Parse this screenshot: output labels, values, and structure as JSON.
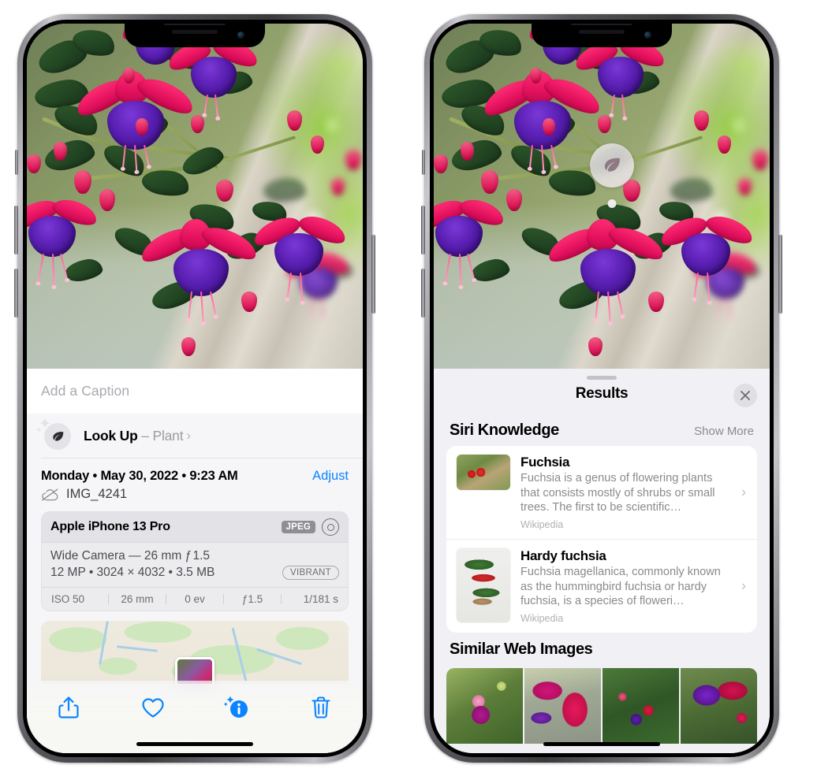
{
  "left_phone": {
    "name": "iphone-photos-info-view",
    "photo": {
      "alt_name": "fuchsia-flowers-photo"
    },
    "caption": {
      "placeholder": "Add a Caption",
      "value": ""
    },
    "look_up": {
      "label": "Look Up",
      "dash": "–",
      "subject": "Plant",
      "chevron": "›",
      "icon": "leaf-icon"
    },
    "date_row": {
      "date_text": "Monday • May 30, 2022 • 9:23 AM",
      "adjust_label": "Adjust"
    },
    "filename_row": {
      "icon": "cloud-slash-icon",
      "filename": "IMG_4241"
    },
    "metadata": {
      "device": "Apple iPhone 13 Pro",
      "format_badge": "JPEG",
      "aperture_icon": "aperture-icon",
      "lens_line": "Wide Camera — 26 mm ƒ 1.5",
      "size_line": "12 MP • 3024 × 4032 • 3.5 MB",
      "style_badge": "VIBRANT",
      "exif": [
        {
          "label": "ISO 50"
        },
        {
          "label": "26 mm"
        },
        {
          "label": "0 ev"
        },
        {
          "label": "ƒ1.5"
        },
        {
          "label": "1/181 s"
        }
      ]
    },
    "map": {
      "name": "location-map-preview",
      "pin": "photo-thumbnail-pin"
    },
    "toolbar": [
      {
        "name": "share-button",
        "icon": "share-icon"
      },
      {
        "name": "favorite-button",
        "icon": "heart-icon"
      },
      {
        "name": "info-button",
        "icon": "info-sparkle-icon"
      },
      {
        "name": "delete-button",
        "icon": "trash-icon"
      }
    ],
    "accent_color": "#0a84ff"
  },
  "right_phone": {
    "name": "iphone-visual-lookup-results",
    "photo_badge": {
      "name": "visual-lookup-leaf-badge",
      "icon": "leaf-icon"
    },
    "sheet": {
      "grabber": "sheet-grabber",
      "title": "Results",
      "close_label": "✕",
      "siri_knowledge": {
        "section_title": "Siri Knowledge",
        "show_more": "Show More",
        "items": [
          {
            "title": "Fuchsia",
            "description": "Fuchsia is a genus of flowering plants that consists mostly of shrubs or small trees. The first to be scientific…",
            "source": "Wikipedia",
            "thumb": "fuchsia-red-flowers-thumbnail"
          },
          {
            "title": "Hardy fuchsia",
            "description": "Fuchsia magellanica, commonly known as the hummingbird fuchsia or hardy fuchsia, is a species of floweri…",
            "source": "Wikipedia",
            "thumb": "hardy-fuchsia-specimen-thumbnail"
          }
        ]
      },
      "similar_web_images": {
        "section_title": "Similar Web Images",
        "thumbs": [
          {
            "name": "web-image-1"
          },
          {
            "name": "web-image-2"
          },
          {
            "name": "web-image-3"
          },
          {
            "name": "web-image-4"
          }
        ]
      }
    }
  }
}
